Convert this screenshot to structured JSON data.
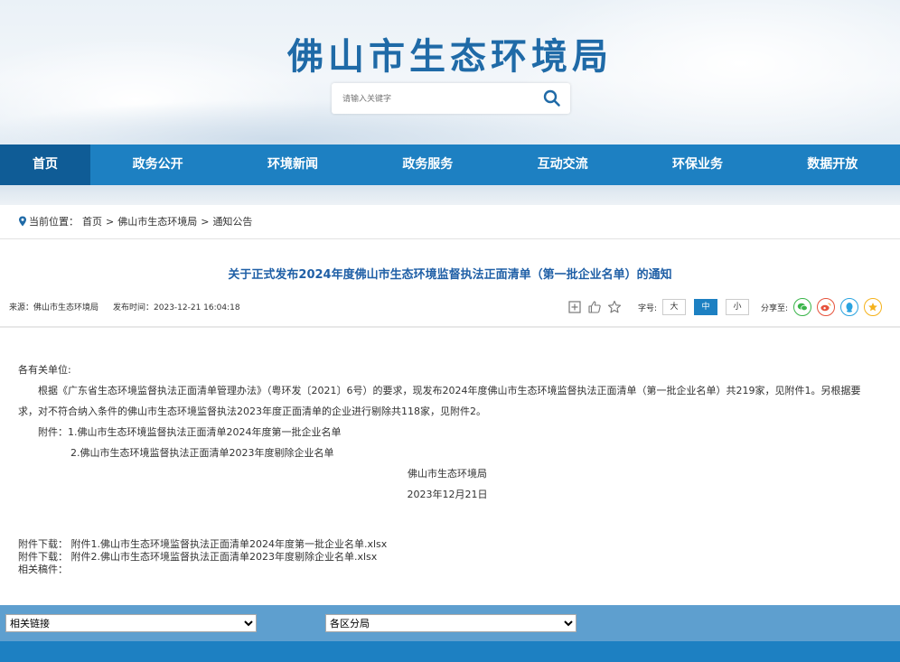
{
  "site": {
    "title": "佛山市生态环境局"
  },
  "search": {
    "placeholder": "请输入关键字"
  },
  "nav": {
    "items": [
      "首页",
      "政务公开",
      "环境新闻",
      "政务服务",
      "互动交流",
      "环保业务",
      "数据开放"
    ]
  },
  "breadcrumb": {
    "label": "当前位置：",
    "items": [
      "首页",
      "佛山市生态环境局",
      "通知公告"
    ],
    "sep": ">"
  },
  "article": {
    "title": "关于正式发布2024年度佛山市生态环境监督执法正面清单（第一批企业名单）的通知",
    "source": "来源：佛山市生态环境局",
    "published": "发布时间：2023-12-21 16:04:18",
    "font_label": "字号:",
    "font_sizes": [
      "大",
      "中",
      "小"
    ],
    "share_label": "分享至:",
    "salutation": "各有关单位:",
    "para1": "根据《广东省生态环境监督执法正面清单管理办法》（粤环发〔2021〕6号）的要求，现发布2024年度佛山市生态环境监督执法正面清单（第一批企业名单）共219家，见附件1。另根据要",
    "para2": "求，对不符合纳入条件的佛山市生态环境监督执法2023年度正面清单的企业进行剔除共118家，见附件2。",
    "attach1": "附件：1.佛山市生态环境监督执法正面清单2024年度第一批企业名单",
    "attach2": "2.佛山市生态环境监督执法正面清单2023年度剔除企业名单",
    "signature": "佛山市生态环境局",
    "date": "2023年12月21日",
    "downloads": [
      "附件下载：  附件1.佛山市生态环境监督执法正面清单2024年度第一批企业名单.xlsx",
      "附件下载：  附件2.佛山市生态环境监督执法正面清单2023年度剔除企业名单.xlsx"
    ],
    "related": "相关稿件："
  },
  "footer": {
    "select1": "相关链接",
    "select2": "各区分局"
  }
}
